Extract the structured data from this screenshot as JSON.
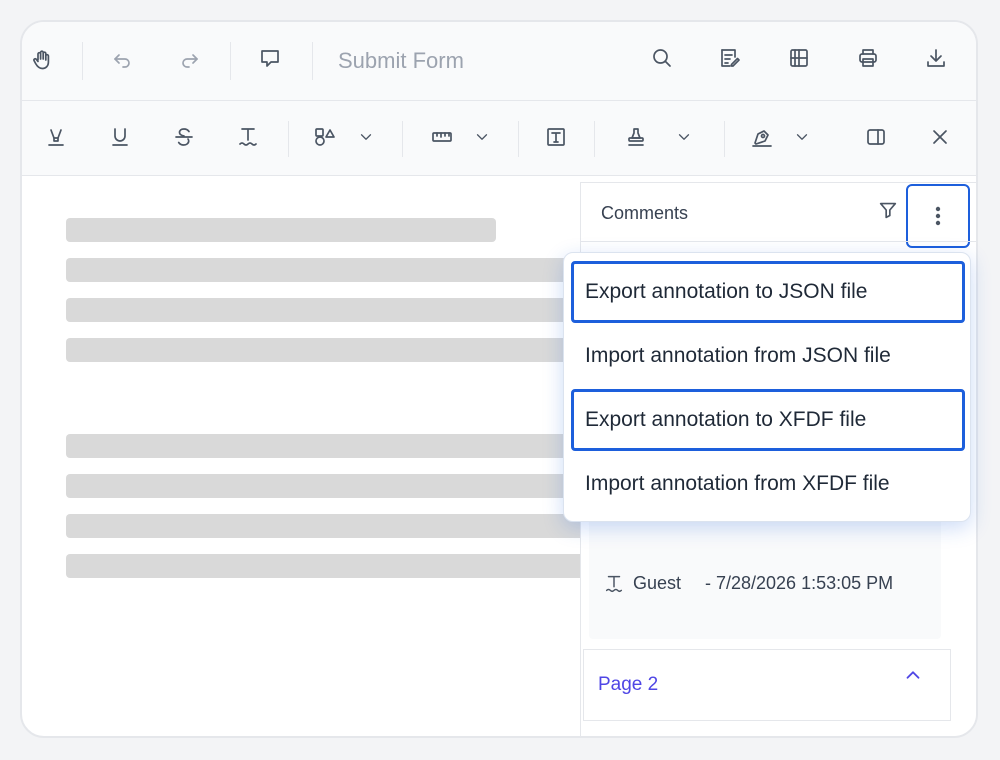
{
  "toolbar_primary": {
    "submit_label": "Submit Form"
  },
  "comments_panel": {
    "title": "Comments",
    "comment": {
      "author": "Guest",
      "date": "- 7/28/2026 1:53:05 PM"
    },
    "page_group": {
      "label": "Page 2"
    }
  },
  "more_menu": {
    "items": [
      {
        "label": "Export annotation to JSON file",
        "focused": true
      },
      {
        "label": "Import annotation from JSON file",
        "focused": false
      },
      {
        "label": "Export annotation to XFDF file",
        "focused": true
      },
      {
        "label": "Import annotation from XFDF file",
        "focused": false
      }
    ]
  },
  "icons": {
    "primary": [
      "pan-hand-icon",
      "undo-icon",
      "redo-icon",
      "comment-icon",
      "search-icon",
      "annotation-edit-icon",
      "organize-pages-icon",
      "print-icon",
      "download-icon"
    ],
    "secondary": [
      "highlight-icon",
      "underline-icon",
      "strikethrough-icon",
      "squiggly-icon",
      "shapes-icon",
      "measure-icon",
      "free-text-icon",
      "stamp-icon",
      "signature-icon",
      "panel-toggle-icon",
      "close-icon"
    ]
  },
  "colors": {
    "accent": "#1d5fdc",
    "page_label": "#4f46e5",
    "placeholder_line": "#d9d9d9"
  }
}
